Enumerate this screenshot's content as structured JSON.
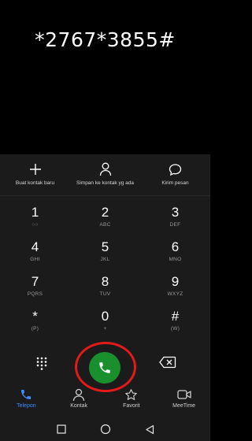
{
  "display": {
    "dialed_number": "*2767*3855#"
  },
  "actions": [
    {
      "label": "Buat kontak baru",
      "icon": "plus-icon"
    },
    {
      "label": "Simpan ke kontak yg ada",
      "icon": "person-icon"
    },
    {
      "label": "Kirim pesan",
      "icon": "message-icon"
    }
  ],
  "keypad": {
    "keys": [
      {
        "digit": "1",
        "sub": "○○"
      },
      {
        "digit": "2",
        "sub": "ABC"
      },
      {
        "digit": "3",
        "sub": "DEF"
      },
      {
        "digit": "4",
        "sub": "GHI"
      },
      {
        "digit": "5",
        "sub": "JKL"
      },
      {
        "digit": "6",
        "sub": "MNO"
      },
      {
        "digit": "7",
        "sub": "PQRS"
      },
      {
        "digit": "8",
        "sub": "TUV"
      },
      {
        "digit": "9",
        "sub": "WXYZ"
      },
      {
        "digit": "*",
        "sub": "(P)"
      },
      {
        "digit": "0",
        "sub": "+"
      },
      {
        "digit": "#",
        "sub": "(W)"
      }
    ]
  },
  "call": {
    "icon": "phone-icon",
    "color": "#1a8f2e",
    "highlight_color": "#e11a1a"
  },
  "nav": [
    {
      "label": "Telepon",
      "icon": "phone-icon",
      "active": true
    },
    {
      "label": "Kontak",
      "icon": "contacts-icon",
      "active": false
    },
    {
      "label": "Favorit",
      "icon": "star-icon",
      "active": false
    },
    {
      "label": "MeeTime",
      "icon": "video-icon",
      "active": false
    }
  ],
  "colors": {
    "accent": "#3a8dff",
    "panel": "#1b1b1b"
  }
}
